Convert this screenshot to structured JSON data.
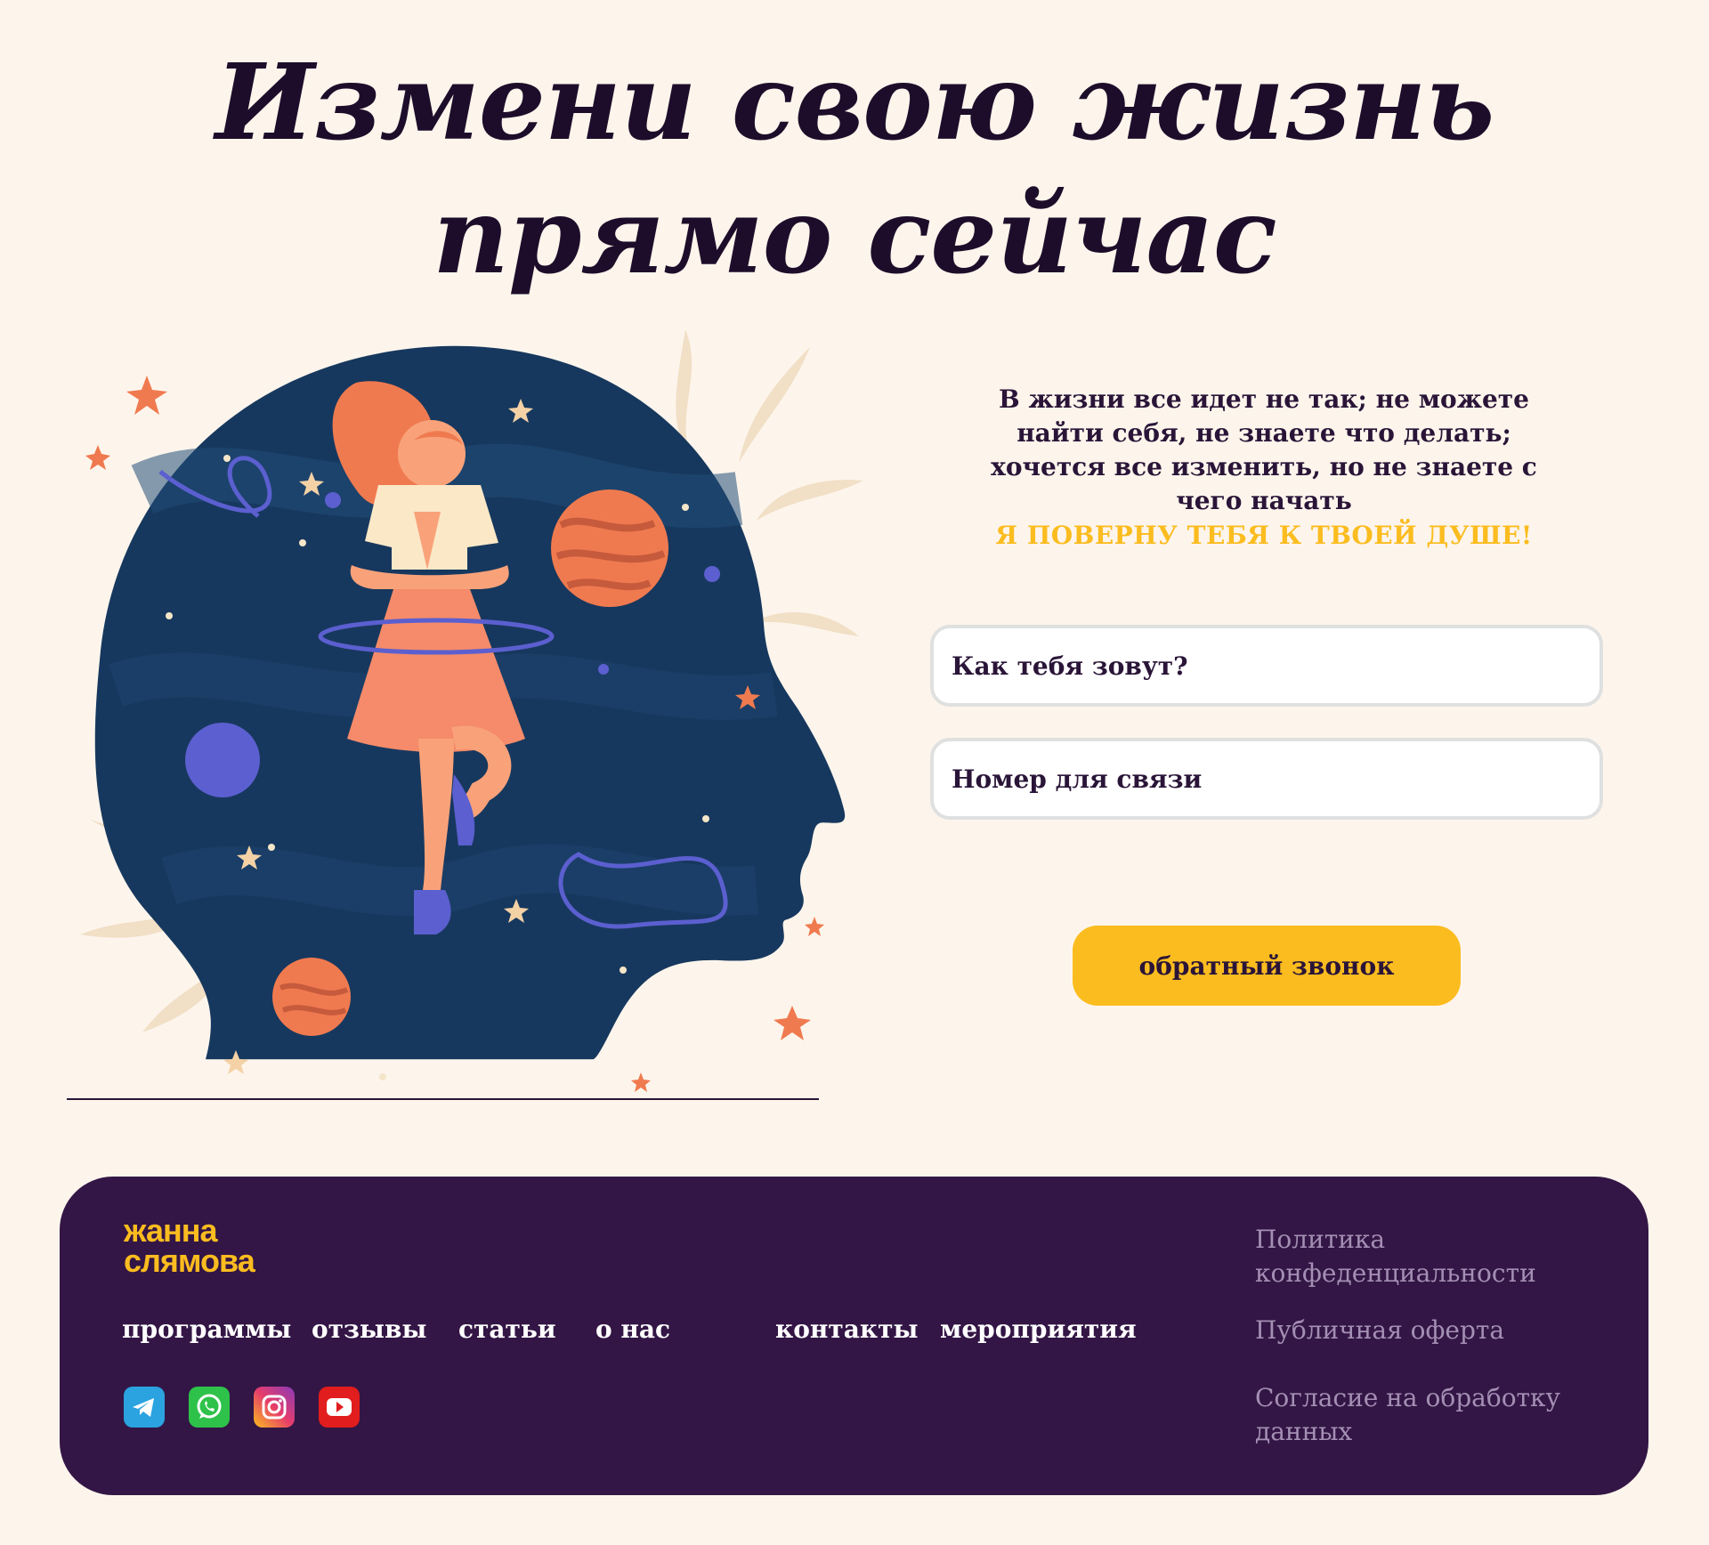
{
  "hero": {
    "title_line1": "Измени свою жизнь",
    "title_line2": "прямо сейчас"
  },
  "intro": {
    "text": "В жизни все идет не так; не можете найти себя, не знаете что делать; хочется все изменить, но не знаете с чего начать",
    "tagline": "Я ПОВЕРНУ ТЕБЯ К ТВОЕЙ ДУШЕ!"
  },
  "form": {
    "name_placeholder": "Как тебя зовут?",
    "phone_placeholder": "Номер для связи",
    "submit_label": "обратный звонок"
  },
  "footer": {
    "logo_line1": "жанна",
    "logo_line2": "слямова",
    "nav": [
      "программы",
      "отзывы",
      "статьи",
      "о нас",
      "контакты",
      "мероприятия"
    ],
    "socials": [
      "telegram-icon",
      "whatsapp-icon",
      "instagram-icon",
      "youtube-icon"
    ],
    "legal": [
      "Политика конфеденциальности",
      "Публичная оферта",
      "Согласие на обработку данных"
    ]
  },
  "colors": {
    "background": "#fdf5ec",
    "accent": "#fbbc1f",
    "footer": "#331645",
    "text": "#2a1538",
    "legal_link": "#a48fb4"
  }
}
